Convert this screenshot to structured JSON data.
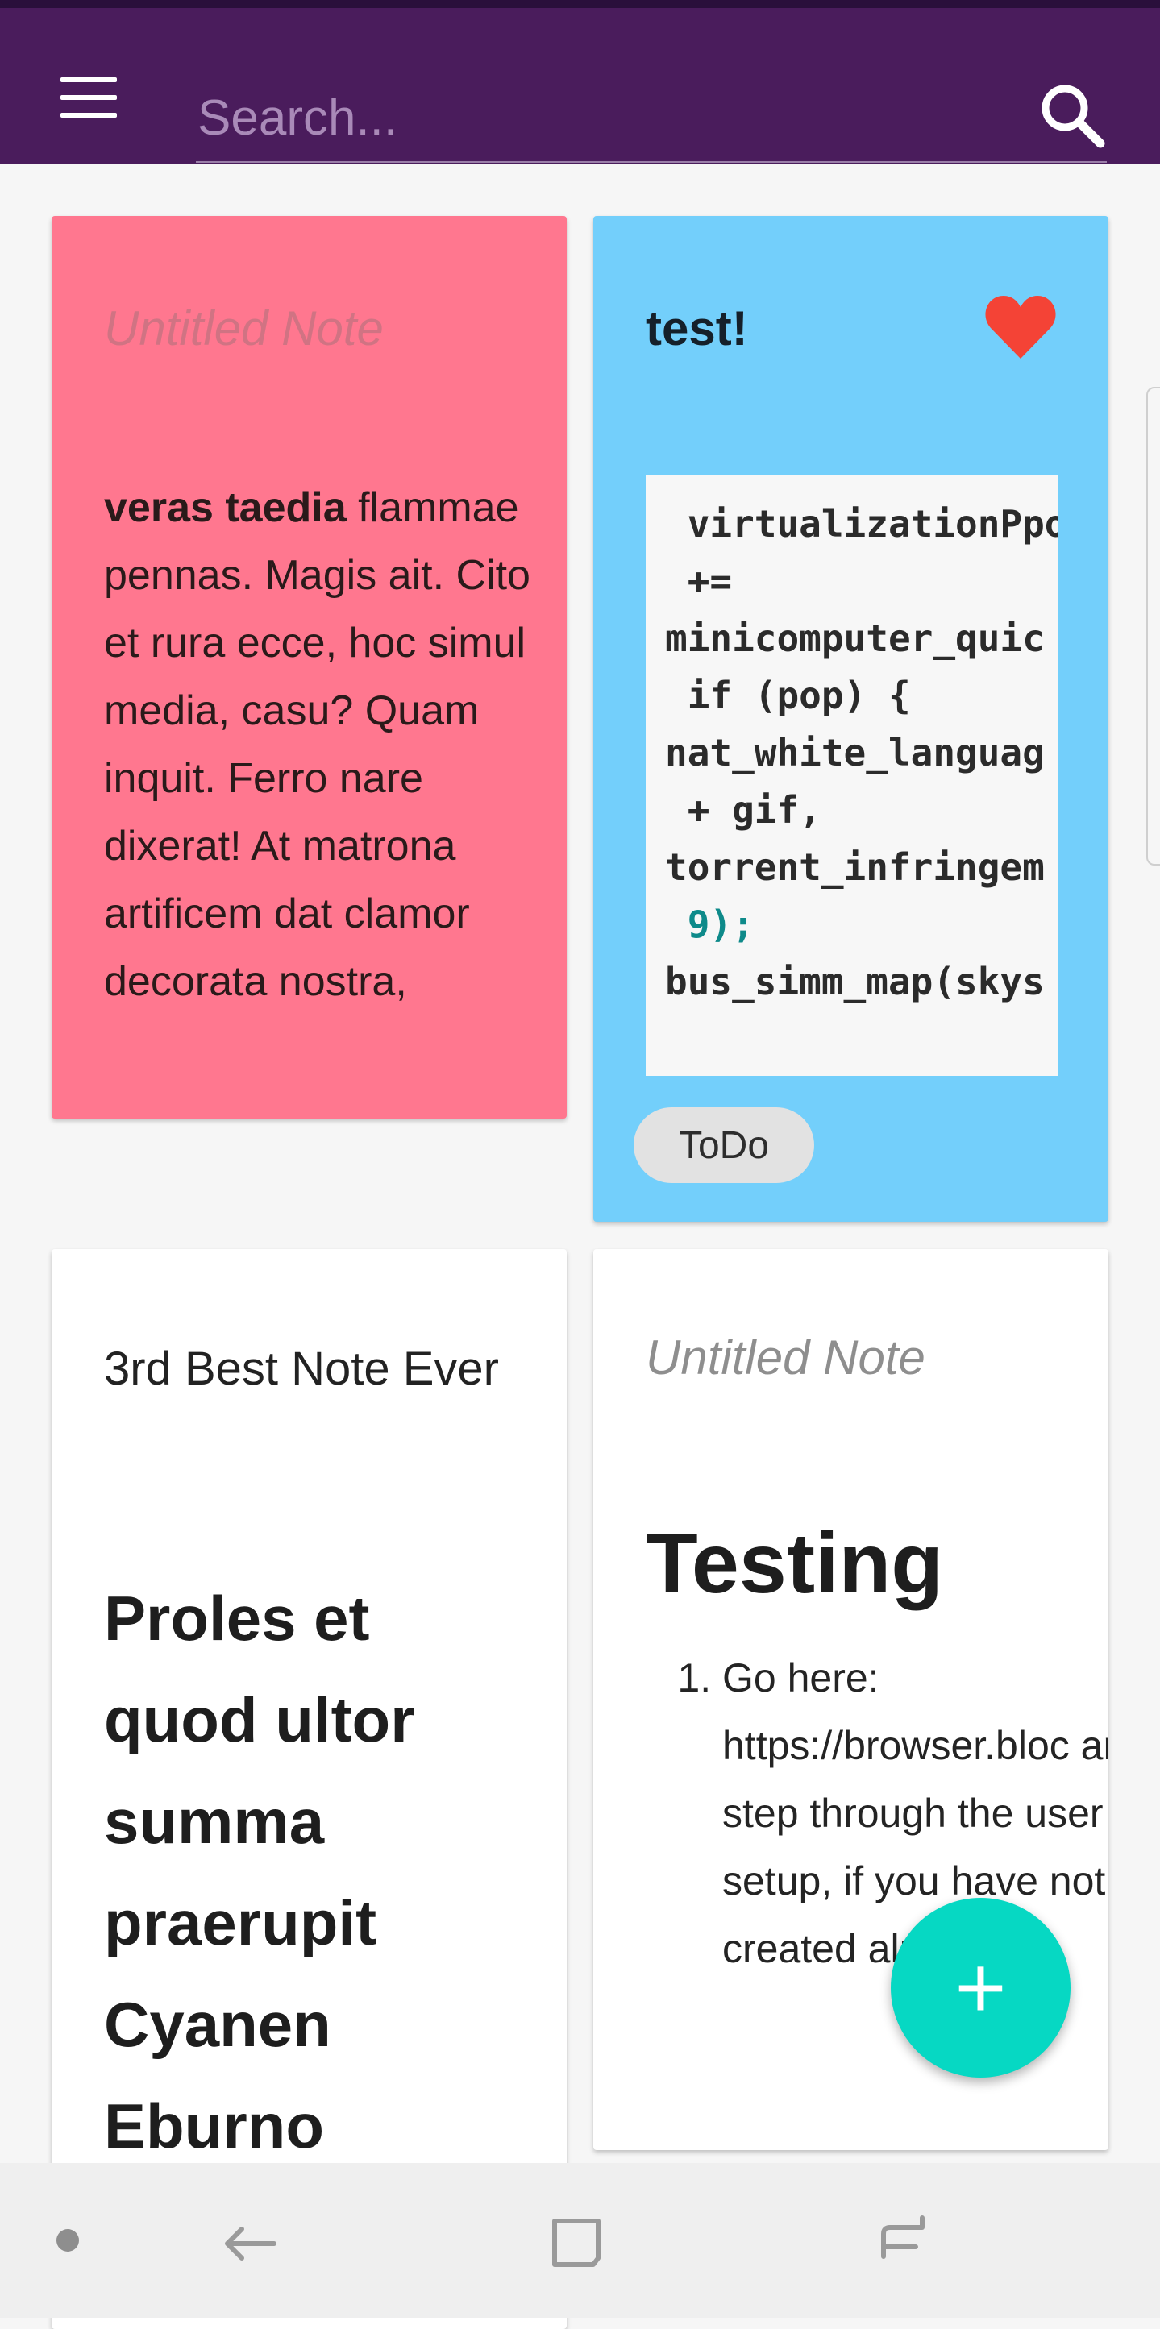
{
  "app_bar": {
    "search_placeholder": "Search..."
  },
  "icons": {
    "menu": "hamburger-menu-icon",
    "search": "magnifier-icon",
    "favorite": "heart-icon",
    "add": "plus-icon"
  },
  "colors": {
    "app_bar": "#4a1c5c",
    "note_pink": "#ff778f",
    "note_blue": "#73cffb",
    "fab": "#06d8c3",
    "heart": "#f44336"
  },
  "notes": [
    {
      "title": "Untitled Note",
      "body_bold": "veras taedia",
      "body": "flammae pennas. Magis ait. Cito et rura ecce, hoc simul media, casu? Quam inquit. Ferro nare dixerat! At matrona artificem dat clamor decorata nostra,"
    },
    {
      "title": "test!",
      "code_lines": [
        " virtualizationPpo",
        " +=",
        "minicomputer_quic",
        " if (pop) {",
        "nat_white_languag",
        " + gif,",
        "torrent_infringem",
        " 9);",
        "bus_simm_map(skys"
      ],
      "tag": "ToDo"
    },
    {
      "title": "3rd Best Note Ever",
      "heading": "Proles et quod ultor summa praerupit Cyanen Eburno"
    },
    {
      "title": "Untitled Note",
      "heading": "Testing",
      "list_item": "Go here: https://browser.bloc and step through the user setup, if you have not have created already."
    }
  ],
  "fab": {
    "label": "+"
  }
}
